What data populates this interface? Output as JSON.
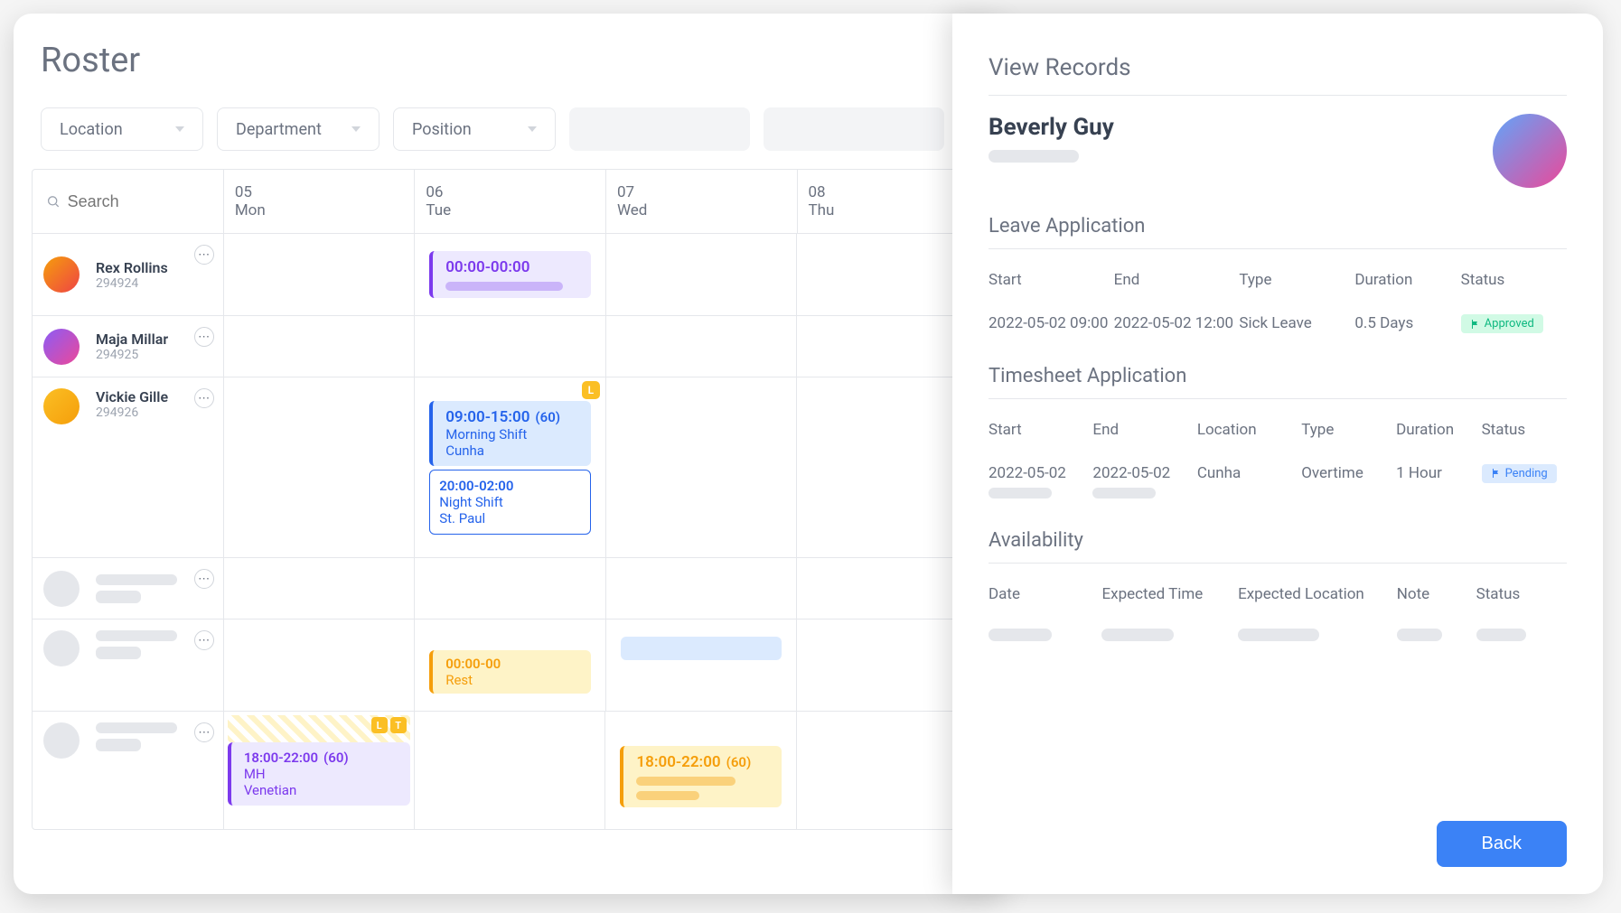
{
  "page_title": "Roster",
  "filters": {
    "location": "Location",
    "department": "Department",
    "position": "Position"
  },
  "search_placeholder": "Search",
  "days": [
    {
      "num": "05",
      "name": "Mon"
    },
    {
      "num": "06",
      "name": "Tue"
    },
    {
      "num": "07",
      "name": "Wed"
    },
    {
      "num": "08",
      "name": "Thu"
    }
  ],
  "employees": [
    {
      "name": "Rex Rollins",
      "id": "294924"
    },
    {
      "name": "Maja Millar",
      "id": "294925"
    },
    {
      "name": "Vickie Gille",
      "id": "294926"
    }
  ],
  "shifts": {
    "rex_tue": {
      "time": "00:00-00:00"
    },
    "vickie_tue_badge": "L",
    "vickie_tue_morning": {
      "time": "09:00-15:00",
      "break": "(60)",
      "label": "Morning Shift",
      "loc": "Cunha"
    },
    "vickie_tue_night": {
      "time": "20:00-02:00",
      "label": "Night Shift",
      "loc": "St. Paul"
    },
    "anon_tue_rest": {
      "time": "00:00-00",
      "label": "Rest"
    },
    "anon2_badges": {
      "l": "L",
      "t": "T"
    },
    "anon2_mon": {
      "time": "18:00-22:00",
      "break": "(60)",
      "label": "MH",
      "loc": "Venetian"
    },
    "anon2_wed": {
      "time": "18:00-22:00",
      "break": "(60)"
    }
  },
  "panel": {
    "title": "View Records",
    "employee_name": "Beverly Guy",
    "leave": {
      "title": "Leave Application",
      "headers": {
        "start": "Start",
        "end": "End",
        "type": "Type",
        "duration": "Duration",
        "status": "Status"
      },
      "row": {
        "start": "2022-05-02 09:00",
        "end": "2022-05-02 12:00",
        "type": "Sick Leave",
        "duration": "0.5 Days",
        "status": "Approved"
      }
    },
    "timesheet": {
      "title": "Timesheet Application",
      "headers": {
        "start": "Start",
        "end": "End",
        "location": "Location",
        "type": "Type",
        "duration": "Duration",
        "status": "Status"
      },
      "row": {
        "start": "2022-05-02",
        "end": "2022-05-02",
        "location": "Cunha",
        "type": "Overtime",
        "duration": "1 Hour",
        "status": "Pending"
      }
    },
    "availability": {
      "title": "Availability",
      "headers": {
        "date": "Date",
        "expected_time": "Expected Time",
        "expected_location": "Expected Location",
        "note": "Note",
        "status": "Status"
      }
    },
    "back": "Back"
  }
}
